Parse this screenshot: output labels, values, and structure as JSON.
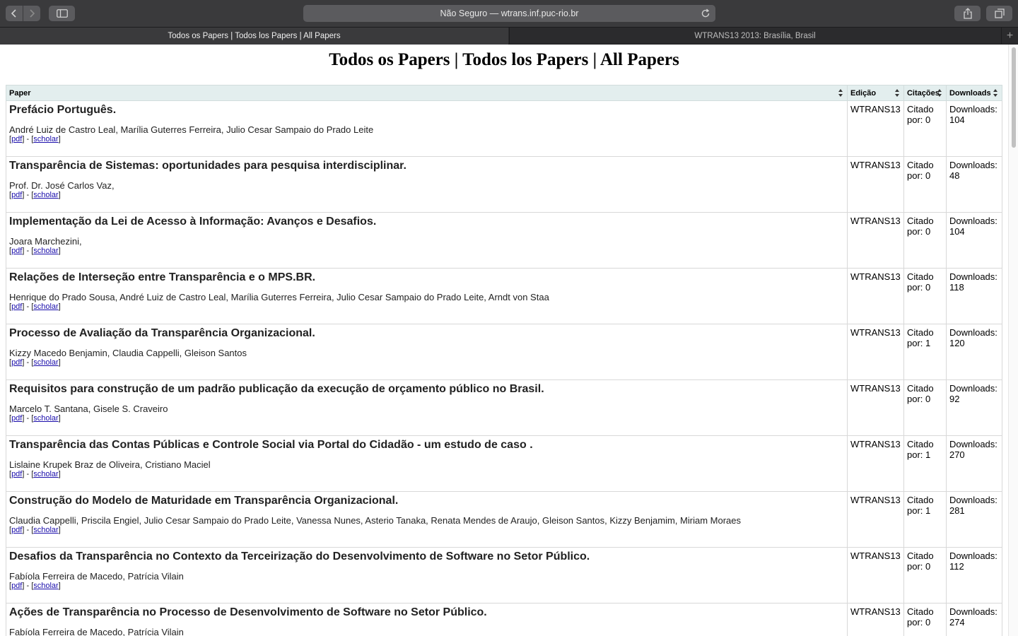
{
  "browser": {
    "url_text": "Não Seguro — wtrans.inf.puc-rio.br",
    "tabs": [
      {
        "label": "Todos os Papers | Todos los Papers | All Papers",
        "active": true
      },
      {
        "label": "WTRANS13 2013: Brasília, Brasil",
        "active": false
      }
    ],
    "new_tab_label": "+"
  },
  "page": {
    "title": "Todos os Papers | Todos los Papers | All Papers",
    "columns": [
      "Paper",
      "Edição",
      "Citações",
      "Downloads"
    ],
    "link_pdf": "pdf",
    "link_scholar": "scholar",
    "rows": [
      {
        "title": "Prefácio Português.",
        "authors": "André Luiz de Castro Leal, Marília Guterres Ferreira, Julio Cesar Sampaio do Prado Leite",
        "edition": "WTRANS13",
        "cited": "Citado por: 0",
        "downloads": "Downloads: 104"
      },
      {
        "title": "Transparência de Sistemas: oportunidades para pesquisa interdisciplinar.",
        "authors": "Prof. Dr. José Carlos Vaz,",
        "edition": "WTRANS13",
        "cited": "Citado por: 0",
        "downloads": "Downloads: 48"
      },
      {
        "title": "Implementação da Lei de Acesso à Informação: Avanços e Desafios.",
        "authors": "Joara Marchezini,",
        "edition": "WTRANS13",
        "cited": "Citado por: 0",
        "downloads": "Downloads: 104"
      },
      {
        "title": "Relações de Interseção entre Transparência e o MPS.BR.",
        "authors": "Henrique do Prado Sousa, André Luiz de Castro Leal, Marília Guterres Ferreira, Julio Cesar Sampaio do Prado Leite, Arndt von Staa",
        "edition": "WTRANS13",
        "cited": "Citado por: 0",
        "downloads": "Downloads: 118"
      },
      {
        "title": "Processo de Avaliação da Transparência Organizacional.",
        "authors": "Kizzy Macedo Benjamin, Claudia Cappelli, Gleison Santos",
        "edition": "WTRANS13",
        "cited": "Citado por: 1",
        "downloads": "Downloads: 120"
      },
      {
        "title": "Requisitos para construção de um padrão publicação da execução de orçamento público no Brasil.",
        "authors": "Marcelo T. Santana, Gisele S. Craveiro",
        "edition": "WTRANS13",
        "cited": "Citado por: 0",
        "downloads": "Downloads: 92"
      },
      {
        "title": "Transparência das Contas Públicas e Controle Social via Portal do Cidadão - um estudo de caso .",
        "authors": "Lislaine Krupek Braz de Oliveira, Cristiano Maciel",
        "edition": "WTRANS13",
        "cited": "Citado por: 1",
        "downloads": "Downloads: 270"
      },
      {
        "title": "Construção do Modelo de Maturidade em Transparência Organizacional.",
        "authors": "Claudia Cappelli, Priscila Engiel, Julio Cesar Sampaio do Prado Leite, Vanessa Nunes, Asterio Tanaka, Renata Mendes de Araujo, Gleison Santos, Kizzy Benjamim, Miriam Moraes",
        "edition": "WTRANS13",
        "cited": "Citado por: 1",
        "downloads": "Downloads: 281"
      },
      {
        "title": "Desafios da Transparência no Contexto da Terceirização do Desenvolvimento de Software no Setor Público.",
        "authors": "Fabíola Ferreira de Macedo, Patrícia Vilain",
        "edition": "WTRANS13",
        "cited": "Citado por: 0",
        "downloads": "Downloads: 112"
      },
      {
        "title": "Ações de Transparência no Processo de Desenvolvimento de Software no Setor Público.",
        "authors": "Fabíola Ferreira de Macedo, Patrícia Vilain",
        "edition": "WTRANS13",
        "cited": "Citado por: 0",
        "downloads": "Downloads: 274"
      }
    ]
  }
}
